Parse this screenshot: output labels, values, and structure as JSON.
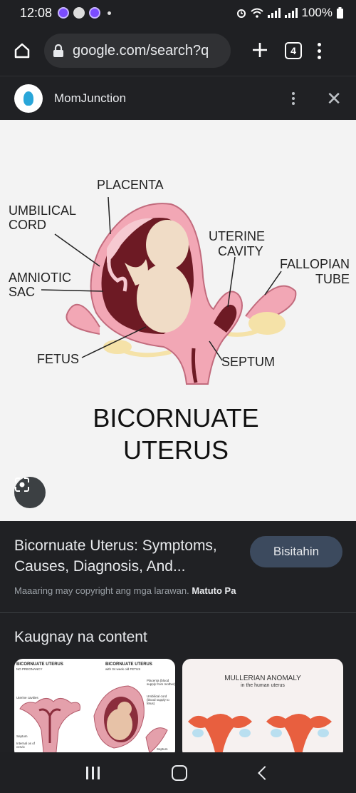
{
  "status_bar": {
    "time": "12:08",
    "battery": "100%",
    "icons": [
      "notification-badge-icon",
      "face-icon",
      "notification-badge-icon",
      "alarm-icon",
      "wifi-icon",
      "signal-icon",
      "signal-icon",
      "battery-icon"
    ]
  },
  "browser": {
    "url": "google.com/search?q",
    "tab_count": "4"
  },
  "source": {
    "name": "MomJunction"
  },
  "diagram": {
    "labels": {
      "placenta": "PLACENTA",
      "umbilical_1": "UMBILICAL",
      "umbilical_2": "CORD",
      "amniotic_1": "AMNIOTIC",
      "amniotic_2": "SAC",
      "fetus": "FETUS",
      "uterine_1": "UTERINE",
      "uterine_2": "CAVITY",
      "fallopian_1": "FALLOPIAN",
      "fallopian_2": "TUBE",
      "septum": "SEPTUM"
    },
    "title_line1": "BICORNUATE",
    "title_line2": "UTERUS"
  },
  "result": {
    "title": "Bicornuate Uterus: Symptoms, Causes, Diagnosis, And...",
    "visit_label": "Bisitahin",
    "copyright_text": "Maaaring may copyright ang mga larawan.",
    "learn_more": "Matuto Pa"
  },
  "related": {
    "heading": "Kaugnay na content",
    "card1": {
      "title_left": "BICORNUATE UTERUS",
      "sub_left": "NO PREGNANCY",
      "title_right": "BICORNUATE UTERUS",
      "sub_right": "with 34 week old FETUS",
      "label_cavities": "Uterine cavities",
      "label_septum": "Septum",
      "label_os": "Internal os of cervix",
      "label_placenta": "Placenta (blood supply from mother)",
      "label_cord": "Umbilical cord (blood supply to fetus)",
      "label_septum2": "Septum"
    },
    "card2": {
      "title": "MULLERIAN ANOMALY",
      "subtitle": "in the human uterus"
    }
  },
  "colors": {
    "page_bg": "#202124",
    "pill_bg": "#303134",
    "button_bg": "#3c4a5e",
    "uterus_pink": "#f2a7b5",
    "uterus_dark": "#6d1a24",
    "fetus_skin": "#f0dcc6"
  }
}
